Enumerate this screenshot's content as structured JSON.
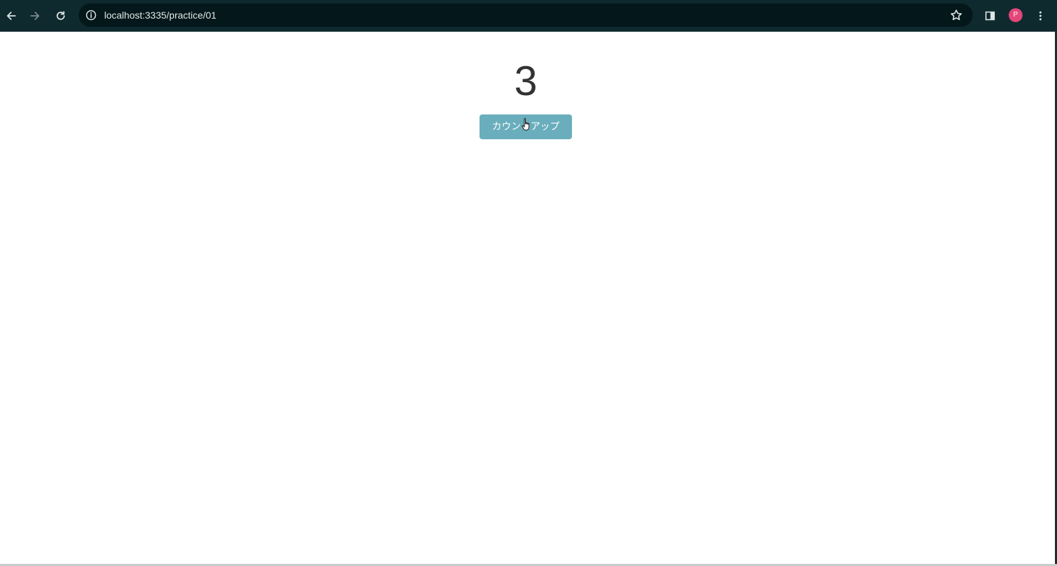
{
  "browser": {
    "url": "localhost:3335/practice/01",
    "profile_initial": "P",
    "colors": {
      "toolbar": "#0f2a2e",
      "omnibox": "#04181b",
      "avatar": "#e4477a"
    },
    "icons": [
      "back-arrow-icon",
      "forward-arrow-icon",
      "reload-icon",
      "site-info-icon",
      "bookmark-star-icon",
      "side-panel-icon",
      "more-menu-icon"
    ]
  },
  "page": {
    "counter_value": "3",
    "button_label": "カウントアップ",
    "colors": {
      "button": "#6aaebd",
      "counter_text": "#333333"
    }
  }
}
